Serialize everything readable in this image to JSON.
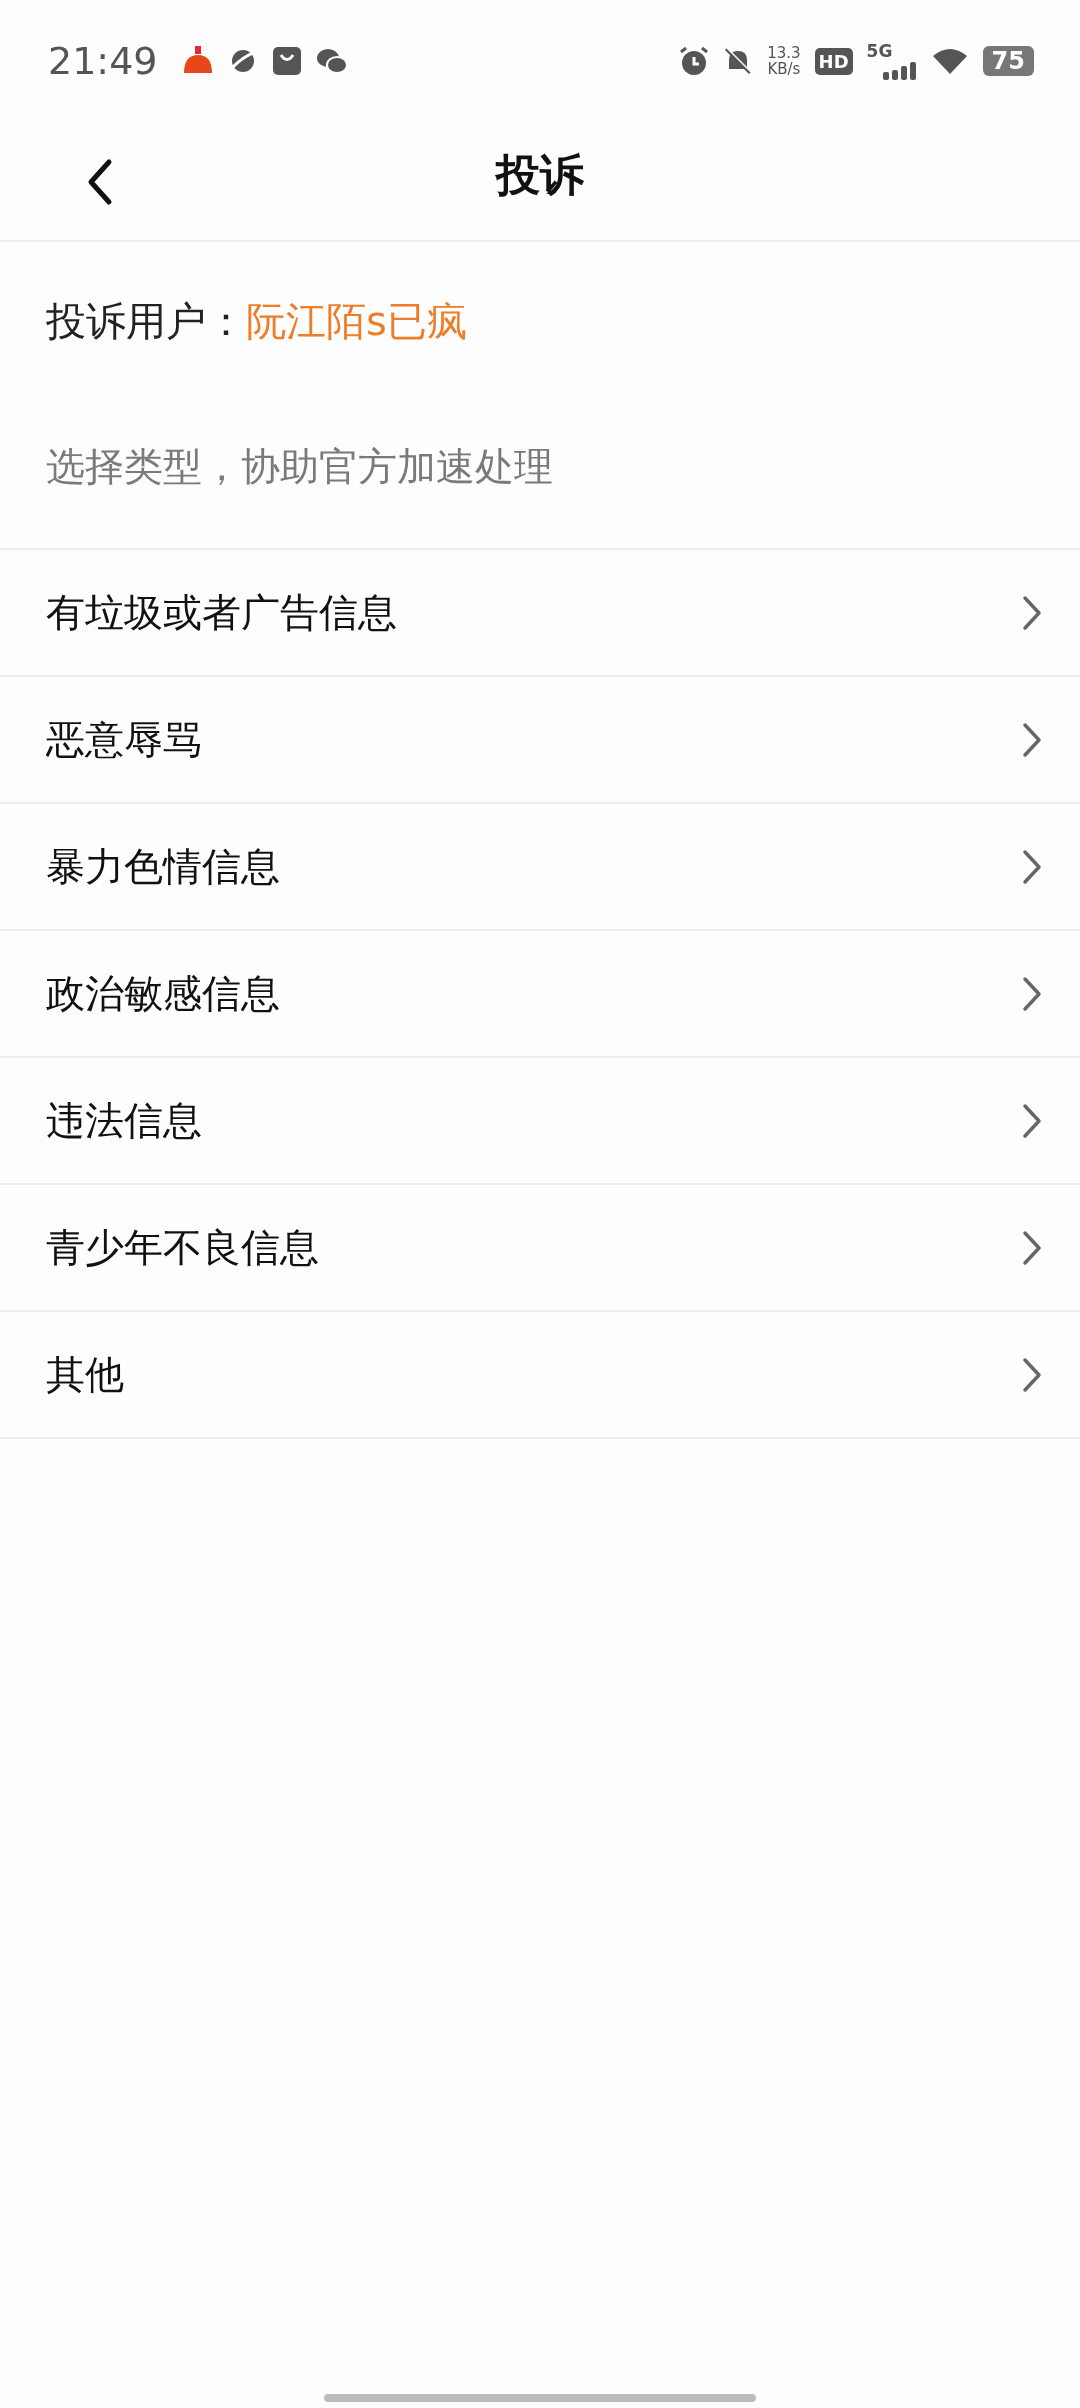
{
  "status_bar": {
    "time": "21:49",
    "net_speed": "13.3",
    "net_unit": "KB/s",
    "hd_badge": "HD",
    "network": "5G",
    "battery": "75"
  },
  "header": {
    "title": "投诉"
  },
  "target": {
    "label": "投诉用户：",
    "user": "阮江陌s已疯"
  },
  "hint": "选择类型，协助官方加速处理",
  "options": [
    {
      "label": "有垃圾或者广告信息"
    },
    {
      "label": "恶意辱骂"
    },
    {
      "label": "暴力色情信息"
    },
    {
      "label": "政治敏感信息"
    },
    {
      "label": "违法信息"
    },
    {
      "label": "青少年不良信息"
    },
    {
      "label": "其他"
    }
  ]
}
